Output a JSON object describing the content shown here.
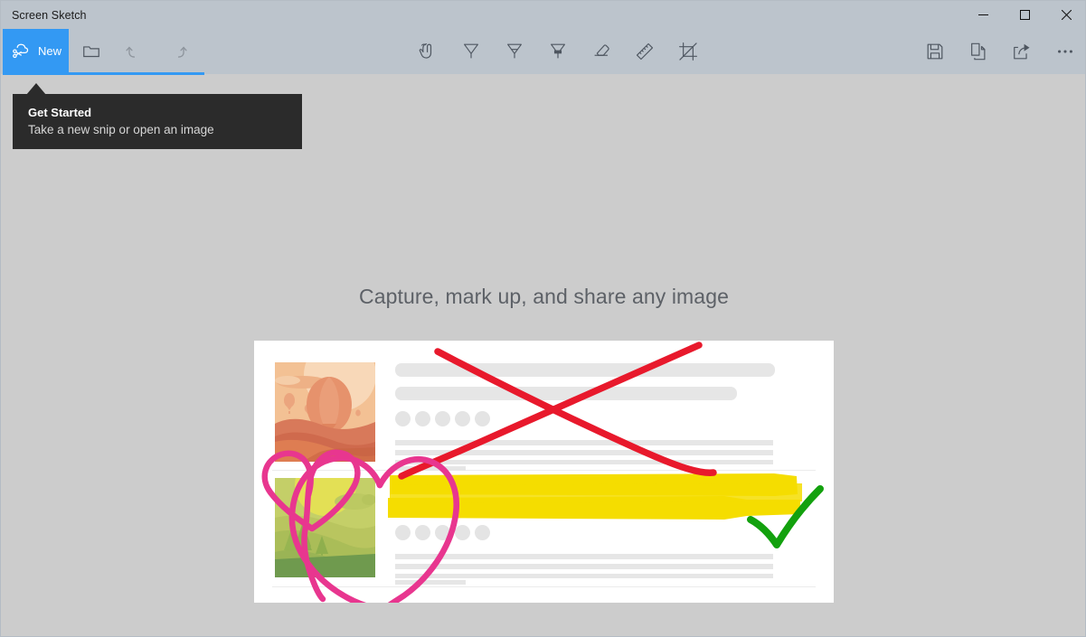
{
  "window": {
    "title": "Screen Sketch",
    "titlebar_color": "#bcc4cc",
    "content_bg": "#cccccc",
    "controls": [
      {
        "name": "minimize",
        "glyph": "─"
      },
      {
        "name": "maximize",
        "glyph": "☐"
      },
      {
        "name": "close",
        "glyph": "✕"
      }
    ]
  },
  "toolbar": {
    "new_label": "New",
    "new_button_color": "#3399f3",
    "new_icon": "snip-scissors-cloud-icon",
    "left_tools": [
      {
        "name": "open-file-icon",
        "label": "Open file",
        "disabled": false
      },
      {
        "name": "undo-icon",
        "label": "Undo",
        "disabled": true
      },
      {
        "name": "redo-icon",
        "label": "Redo",
        "disabled": true
      }
    ],
    "center_tools": [
      {
        "name": "touch-writing-icon",
        "label": "Touch writing"
      },
      {
        "name": "ballpoint-pen-icon",
        "label": "Ballpoint pen"
      },
      {
        "name": "pencil-icon",
        "label": "Pencil"
      },
      {
        "name": "highlighter-icon",
        "label": "Highlighter"
      },
      {
        "name": "eraser-icon",
        "label": "Eraser"
      },
      {
        "name": "ruler-icon",
        "label": "Ruler"
      },
      {
        "name": "crop-icon",
        "label": "Image crop"
      }
    ],
    "right_tools": [
      {
        "name": "save-icon",
        "label": "Save as"
      },
      {
        "name": "copy-icon",
        "label": "Copy"
      },
      {
        "name": "share-icon",
        "label": "Share"
      },
      {
        "name": "more-icon",
        "label": "See more"
      }
    ]
  },
  "callout": {
    "title": "Get Started",
    "subtitle": "Take a new snip or open an image",
    "background": "#2b2b2b"
  },
  "hero": {
    "headline": "Capture, mark up, and share any image"
  },
  "illustration": {
    "card_background": "#ffffff",
    "ink": {
      "cross_color": "#e8192c",
      "heart_color": "#e8368f",
      "highlight_color": "#f5dd00",
      "check_color": "#13a10e"
    },
    "thumbnails": [
      {
        "name": "desert-balloon-thumbnail",
        "alt": "Hot air balloon over desert dunes"
      },
      {
        "name": "green-hills-thumbnail",
        "alt": "Green hills with pine trees and sun"
      }
    ]
  }
}
